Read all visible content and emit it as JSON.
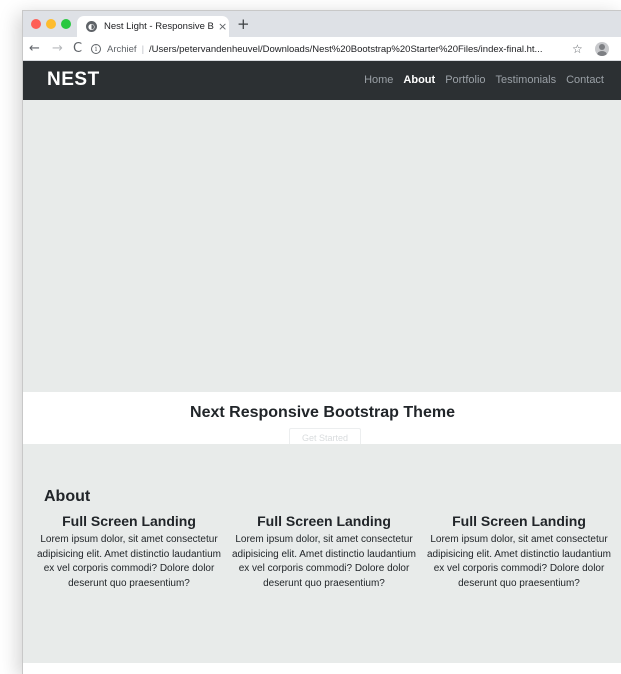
{
  "browser": {
    "tab_title": "Nest Light - Responsive Bootst",
    "tab_close": "×",
    "new_tab": "+",
    "back": "←",
    "forward": "→",
    "reload": "C",
    "info": "i",
    "scheme_label": "Archief",
    "separator": "|",
    "url": "/Users/petervandenheuvel/Downloads/Nest%20Bootstrap%20Starter%20Files/index-final.ht...",
    "bookmark": "☆"
  },
  "navbar": {
    "brand": "NEST",
    "links": [
      {
        "label": "Home",
        "active": false
      },
      {
        "label": "About",
        "active": true
      },
      {
        "label": "Portfolio",
        "active": false
      },
      {
        "label": "Testimonials",
        "active": false
      },
      {
        "label": "Contact",
        "active": false
      }
    ]
  },
  "hero": {
    "title": "Next Responsive Bootstrap Theme",
    "cta_label": "Get Started"
  },
  "about": {
    "heading": "About",
    "features": [
      {
        "title": "Full Screen Landing",
        "text": "Lorem ipsum dolor, sit amet consectetur adipisicing elit. Amet distinctio laudantium ex vel corporis commodi? Dolore dolor deserunt quo praesentium?"
      },
      {
        "title": "Full Screen Landing",
        "text": "Lorem ipsum dolor, sit amet consectetur adipisicing elit. Amet distinctio laudantium ex vel corporis commodi? Dolore dolor deserunt quo praesentium?"
      },
      {
        "title": "Full Screen Landing",
        "text": "Lorem ipsum dolor, sit amet consectetur adipisicing elit. Amet distinctio laudantium ex vel corporis commodi? Dolore dolor deserunt quo praesentium?"
      }
    ]
  },
  "colors": {
    "navbar_bg": "#2c3033",
    "section_bg": "#e8ebea",
    "traffic_red": "#fe5f57",
    "traffic_yellow": "#febc2e",
    "traffic_green": "#28c840"
  }
}
